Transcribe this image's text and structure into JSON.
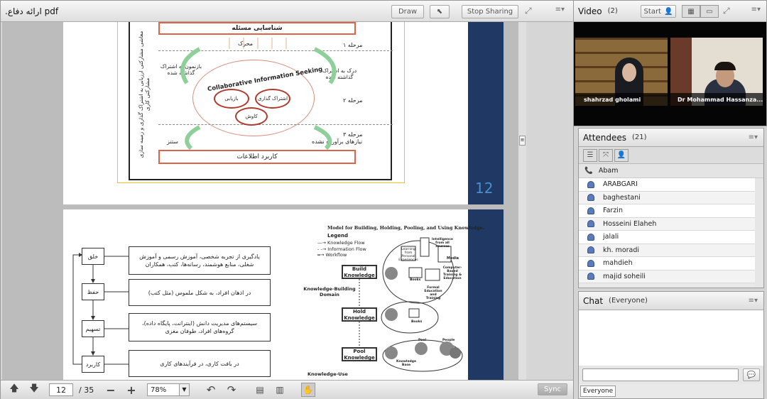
{
  "share": {
    "filename": ".ارائه دفاع pdf",
    "draw_label": "Draw",
    "stop_sharing_label": "Stop Sharing",
    "page_current": "12",
    "page_total": "/ 35",
    "zoom": "78%",
    "sync_label": "Sync"
  },
  "slide1": {
    "top_bar": "شناسایی مسئله",
    "bottom_bar": "کاربرد اطلاعات",
    "stage1": "مرحله ۱",
    "stage2": "مرحله ۲",
    "stage3": "مرحله ۳",
    "motor": "محرک",
    "arc_text": "Collaborative Information Seeking",
    "left_mid": "بازنمون به اشتراک گذاشته شده",
    "right_mid": "درک به اشتراک گذاشته شده",
    "circle1": "اشتراک گذاری",
    "circle2": "بازیابی",
    "circle3": "کاوش",
    "bottom_left": "ستنز",
    "bottom_right": "نیازهای برآورده نشده",
    "side_text": "معاشی مشارکتی ارزیابی به اشتراک گذاری و زمینه سازی مشارکتی کاری",
    "page_number": "12"
  },
  "slide2": {
    "title": "Model for Building, Holding, Pooling, and Using Knowledge.",
    "legend_title": "Legend",
    "legend_items": [
      "Knowledge Flow",
      "Information Flow",
      "Workflow"
    ],
    "steps": [
      "خلق",
      "حفظ",
      "تسهیم",
      "کاربرد"
    ],
    "descriptions": [
      "یادگیری از تجربه شخصی، آموزش رسمی و آموزش شغلی، منابع هوشمند، رسانه‌ها، کتب، همکاران",
      "در اذهان افراد، به شکل ملموس (مثل کتب)",
      "سیستم‌های مدیریت دانش (اینترانت، پایگاه داده)، گروه‌های افراد، طوفان مغزی",
      "در بافت کاری، در فرآیندهای کاری"
    ],
    "knowledge_boxes": [
      "Build Knowledge",
      "Hold Knowledge",
      "Pool Knowledge"
    ],
    "domain_build": "Knowledge-Building Domain",
    "domain_use": "Knowledge-Use",
    "source_labels": [
      "Learning from Personal Experiences",
      "Intelligence from all sources",
      "Media",
      "Computer-Based Training & Education",
      "Formal Education and Training",
      "Books",
      "Books",
      "Knowledge Base",
      "People",
      "Pool"
    ]
  },
  "video": {
    "title": "Video",
    "count": "(2)",
    "start_label": "Start",
    "participants": [
      "shahrzad gholami",
      "Dr Mohammad Hassanza..."
    ]
  },
  "attendees": {
    "title": "Attendees",
    "count": "(21)",
    "host": "Abam",
    "list": [
      "ARABGARI",
      "baghestani",
      "Farzin",
      "Hosseini Elaheh",
      "jalali",
      "kh. moradi",
      "mahdieh",
      "majid soheili"
    ]
  },
  "chat": {
    "title": "Chat",
    "scope": "(Everyone)",
    "tab_label": "Everyone"
  },
  "colors": {
    "accent_navy": "#1f3864",
    "slide_red": "#c0392b",
    "arrow_green": "#8fcf9a"
  }
}
